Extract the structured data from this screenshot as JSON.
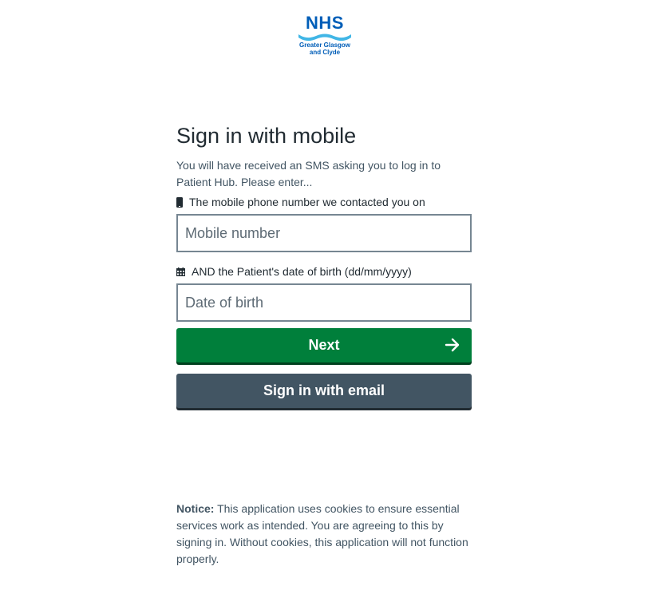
{
  "logo": {
    "brand": "NHS",
    "line1": "Greater Glasgow",
    "line2": "and Clyde",
    "color": "#005eb8"
  },
  "form": {
    "title": "Sign in with mobile",
    "intro": "You will have received an SMS asking you to log in to Patient Hub. Please enter...",
    "mobile": {
      "icon": "mobile-phone-icon",
      "label": "The mobile phone number we contacted you on",
      "placeholder": "Mobile number",
      "value": ""
    },
    "dob": {
      "icon": "calendar-icon",
      "label": "AND the Patient's date of birth (dd/mm/yyyy)",
      "placeholder": "Date of birth",
      "value": ""
    },
    "next_button": {
      "label": "Next",
      "icon": "arrow-right-icon",
      "color": "#007f3b"
    },
    "email_button": {
      "label": "Sign in with email",
      "color": "#425563"
    }
  },
  "notice": {
    "heading": "Notice:",
    "text": " This application uses cookies to ensure essential services work as intended. You are agreeing to this by signing in. Without cookies, this application will not function properly."
  }
}
